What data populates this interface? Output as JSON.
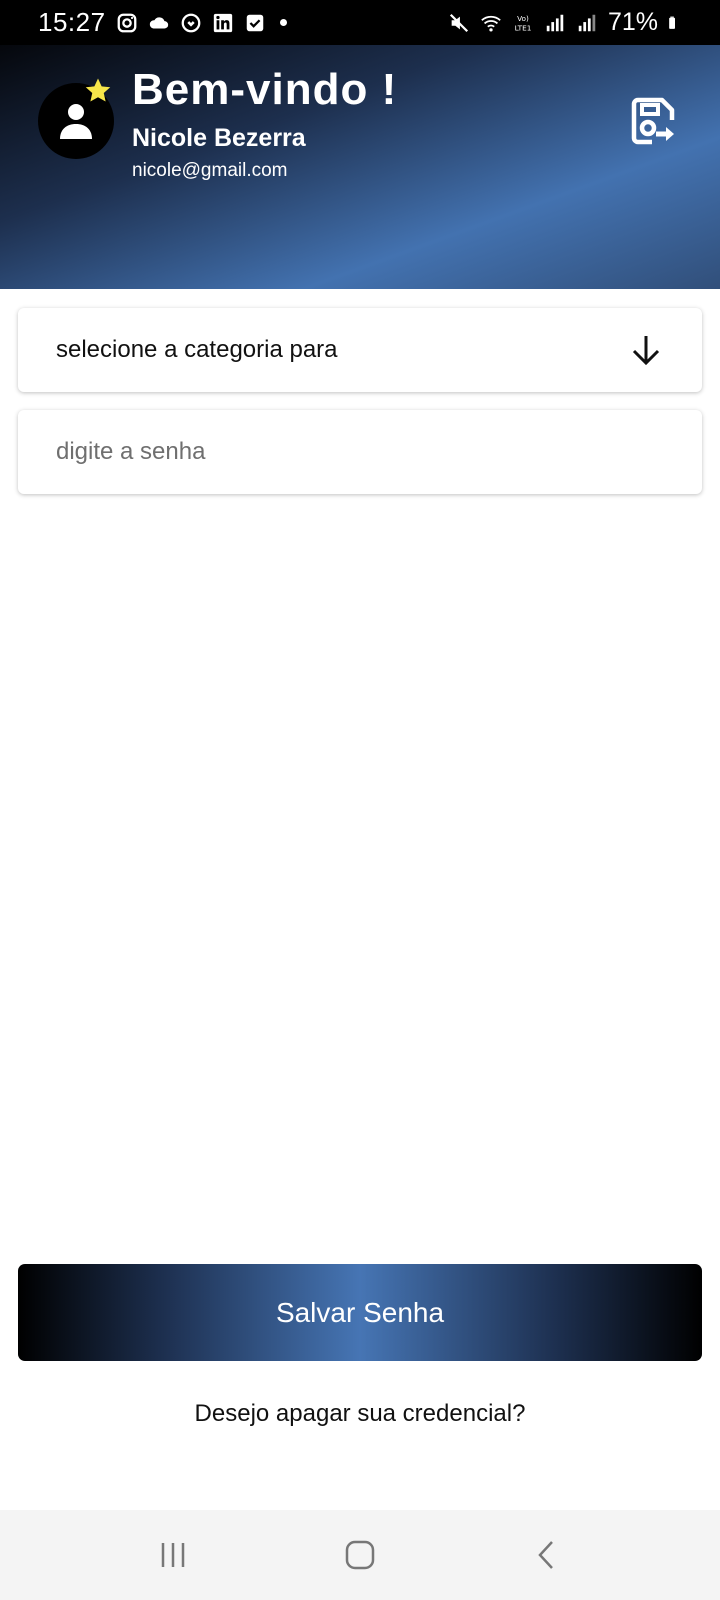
{
  "status_bar": {
    "time": "15:27",
    "battery": "71%",
    "icons": [
      "instagram-icon",
      "cloud-icon",
      "sync-icon",
      "linkedin-icon",
      "check-icon",
      "mute-icon",
      "wifi-icon",
      "lte-icon",
      "signal-icon",
      "signal-icon",
      "battery-icon"
    ]
  },
  "header": {
    "welcome": "Bem-vindo !",
    "user_name": "Nicole Bezerra",
    "user_email": "nicole@gmail.com",
    "colors": {
      "gradient_dark": "#05070c",
      "gradient_light": "#4372b0",
      "star": "#f7e64a"
    }
  },
  "form": {
    "category_select_label": "selecione a categoria para",
    "password_value": "",
    "password_placeholder": "digite a senha"
  },
  "actions": {
    "save_label": "Salvar Senha",
    "delete_label": "Desejo apagar sua credencial?"
  }
}
